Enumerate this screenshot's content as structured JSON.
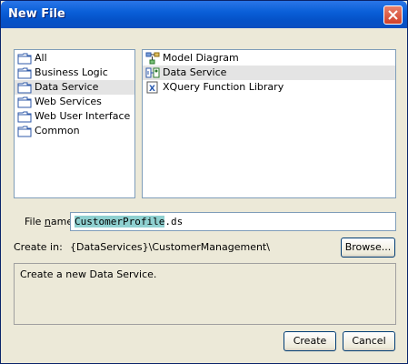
{
  "window": {
    "title": "New File"
  },
  "categories": [
    {
      "label": "All",
      "icon": "folder-icon"
    },
    {
      "label": "Business Logic",
      "icon": "folder-icon"
    },
    {
      "label": "Data Service",
      "icon": "folder-icon",
      "selected": true
    },
    {
      "label": "Web Services",
      "icon": "folder-icon"
    },
    {
      "label": "Web User Interface",
      "icon": "folder-icon"
    },
    {
      "label": "Common",
      "icon": "folder-icon"
    }
  ],
  "file_types": [
    {
      "label": "Model Diagram",
      "icon": "model-diagram-icon"
    },
    {
      "label": "Data Service",
      "icon": "data-service-icon",
      "selected": true
    },
    {
      "label": "XQuery Function Library",
      "icon": "xquery-function-library-icon"
    }
  ],
  "file_name": {
    "label_prefix": "File ",
    "label_mnemonic": "n",
    "label_suffix": "ame:",
    "value_selected": "CustomerProfile",
    "value_rest": ".ds"
  },
  "create_in": {
    "label": "Create in:",
    "path": "{DataServices}\\CustomerManagement\\",
    "browse_label": "Browse..."
  },
  "description": "Create a new Data Service.",
  "buttons": {
    "create": "Create",
    "cancel": "Cancel"
  },
  "colors": {
    "titlebar": "#0a5fd8",
    "selection": "#8fd0d0",
    "window_bg": "#ece9d8"
  }
}
